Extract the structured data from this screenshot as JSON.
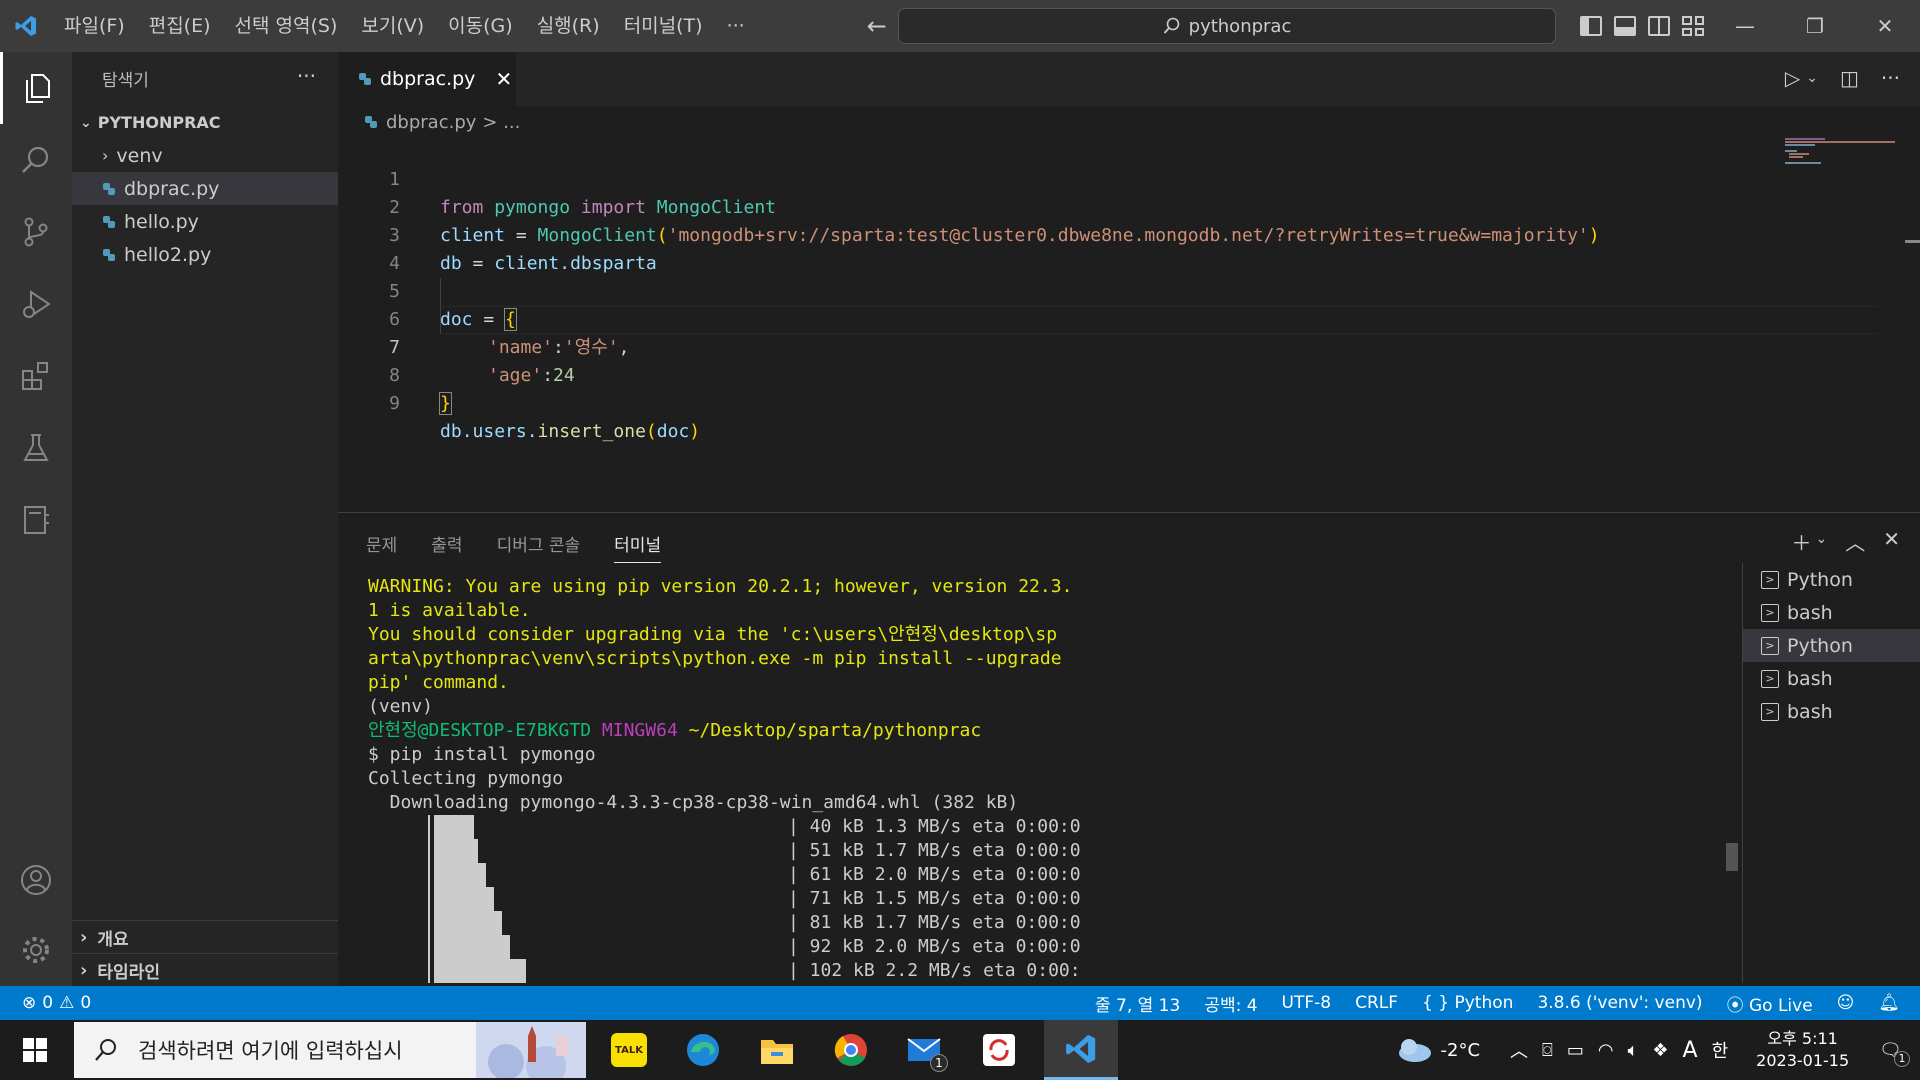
{
  "titlebar": {
    "menu": [
      "파일(F)",
      "편집(E)",
      "선택 영역(S)",
      "보기(V)",
      "이동(G)",
      "실행(R)",
      "터미널(T)",
      "···"
    ],
    "search_text": "pythonprac"
  },
  "sidebar": {
    "title": "탐색기",
    "more": "···",
    "root": "PYTHONPRAC",
    "items": [
      {
        "label": "venv"
      },
      {
        "label": "dbprac.py"
      },
      {
        "label": "hello.py"
      },
      {
        "label": "hello2.py"
      }
    ],
    "sections": [
      "개요",
      "타임라인"
    ]
  },
  "editor": {
    "tab_label": "dbprac.py",
    "breadcrumb_file": "dbprac.py",
    "breadcrumb_rest": "> ...",
    "line_numbers": [
      "1",
      "2",
      "3",
      "4",
      "5",
      "6",
      "7",
      "8",
      "9"
    ],
    "code": {
      "l1_from": "from",
      "l1_mod": "pymongo",
      "l1_import": "import",
      "l1_cls": "MongoClient",
      "l2_var": "client",
      "l2_eq": " = ",
      "l2_fn": "MongoClient",
      "l2_open": "(",
      "l2_str": "'mongodb+srv://sparta:test@cluster0.dbwe8ne.mongodb.net/?retryWrites=true&w=majority'",
      "l2_close": ")",
      "l3_var": "db",
      "l3_eq": " = ",
      "l3_obj": "client",
      "l3_attr": ".dbsparta",
      "l5_var": "doc",
      "l5_eq": " = ",
      "l5_brace": "{",
      "l6_key": "'name'",
      "l6_colon": ":",
      "l6_val": "'영수'",
      "l6_comma": ",",
      "l7_key": "'age'",
      "l7_colon": ":",
      "l7_val": "24",
      "l8_brace": "}",
      "l9_db": "db",
      "l9_users": ".users.",
      "l9_fn": "insert_one",
      "l9_open": "(",
      "l9_arg": "doc",
      "l9_close": ")"
    }
  },
  "panel": {
    "tabs": [
      "문제",
      "출력",
      "디버그 콘솔",
      "터미널"
    ],
    "terminal_lines": {
      "w1": "WARNING: You are using pip version 20.2.1; however, version 22.3.",
      "w2": "1 is available.",
      "w3": "You should consider upgrading via the 'c:\\users\\안현정\\desktop\\sp",
      "w4": "arta\\pythonprac\\venv\\scripts\\python.exe -m pip install --upgrade",
      "w5": "pip' command.",
      "venv": "(venv)",
      "prompt_user": "안현정@DESKTOP-E7BKGTD",
      "prompt_shell": "MINGW64",
      "prompt_path": "~/Desktop/sparta/pythonprac",
      "cmd": "$ pip install pymongo",
      "collect": "Collecting pymongo",
      "download": "  Downloading pymongo-4.3.3-cp38-cp38-win_amd64.whl (382 kB)",
      "progress": [
        "| 40 kB 1.3 MB/s eta 0:00:0",
        "| 51 kB 1.7 MB/s eta 0:00:0",
        "| 61 kB 2.0 MB/s eta 0:00:0",
        "| 71 kB 1.5 MB/s eta 0:00:0",
        "| 81 kB 1.7 MB/s eta 0:00:0",
        "| 92 kB 2.0 MB/s eta 0:00:0",
        "| 102 kB 2.2 MB/s eta 0:00:"
      ]
    },
    "terminals": [
      {
        "label": "Python"
      },
      {
        "label": "bash"
      },
      {
        "label": "Python"
      },
      {
        "label": "bash"
      },
      {
        "label": "bash"
      }
    ]
  },
  "statusbar": {
    "errors": "0",
    "warnings": "0",
    "position": "줄 7, 열 13",
    "spaces": "공백: 4",
    "encoding": "UTF-8",
    "eol": "CRLF",
    "language": "Python",
    "interpreter": "3.8.6 ('venv': venv)",
    "golive": "Go Live"
  },
  "taskbar": {
    "search_placeholder": "검색하려면 여기에 입력하십시",
    "kakao": "TALK",
    "weather": "-2°C",
    "ime": "A",
    "ime2": "한",
    "time": "오후 5:11",
    "date": "2023-01-15",
    "mail_badge": "1",
    "notif_badge": "1"
  }
}
